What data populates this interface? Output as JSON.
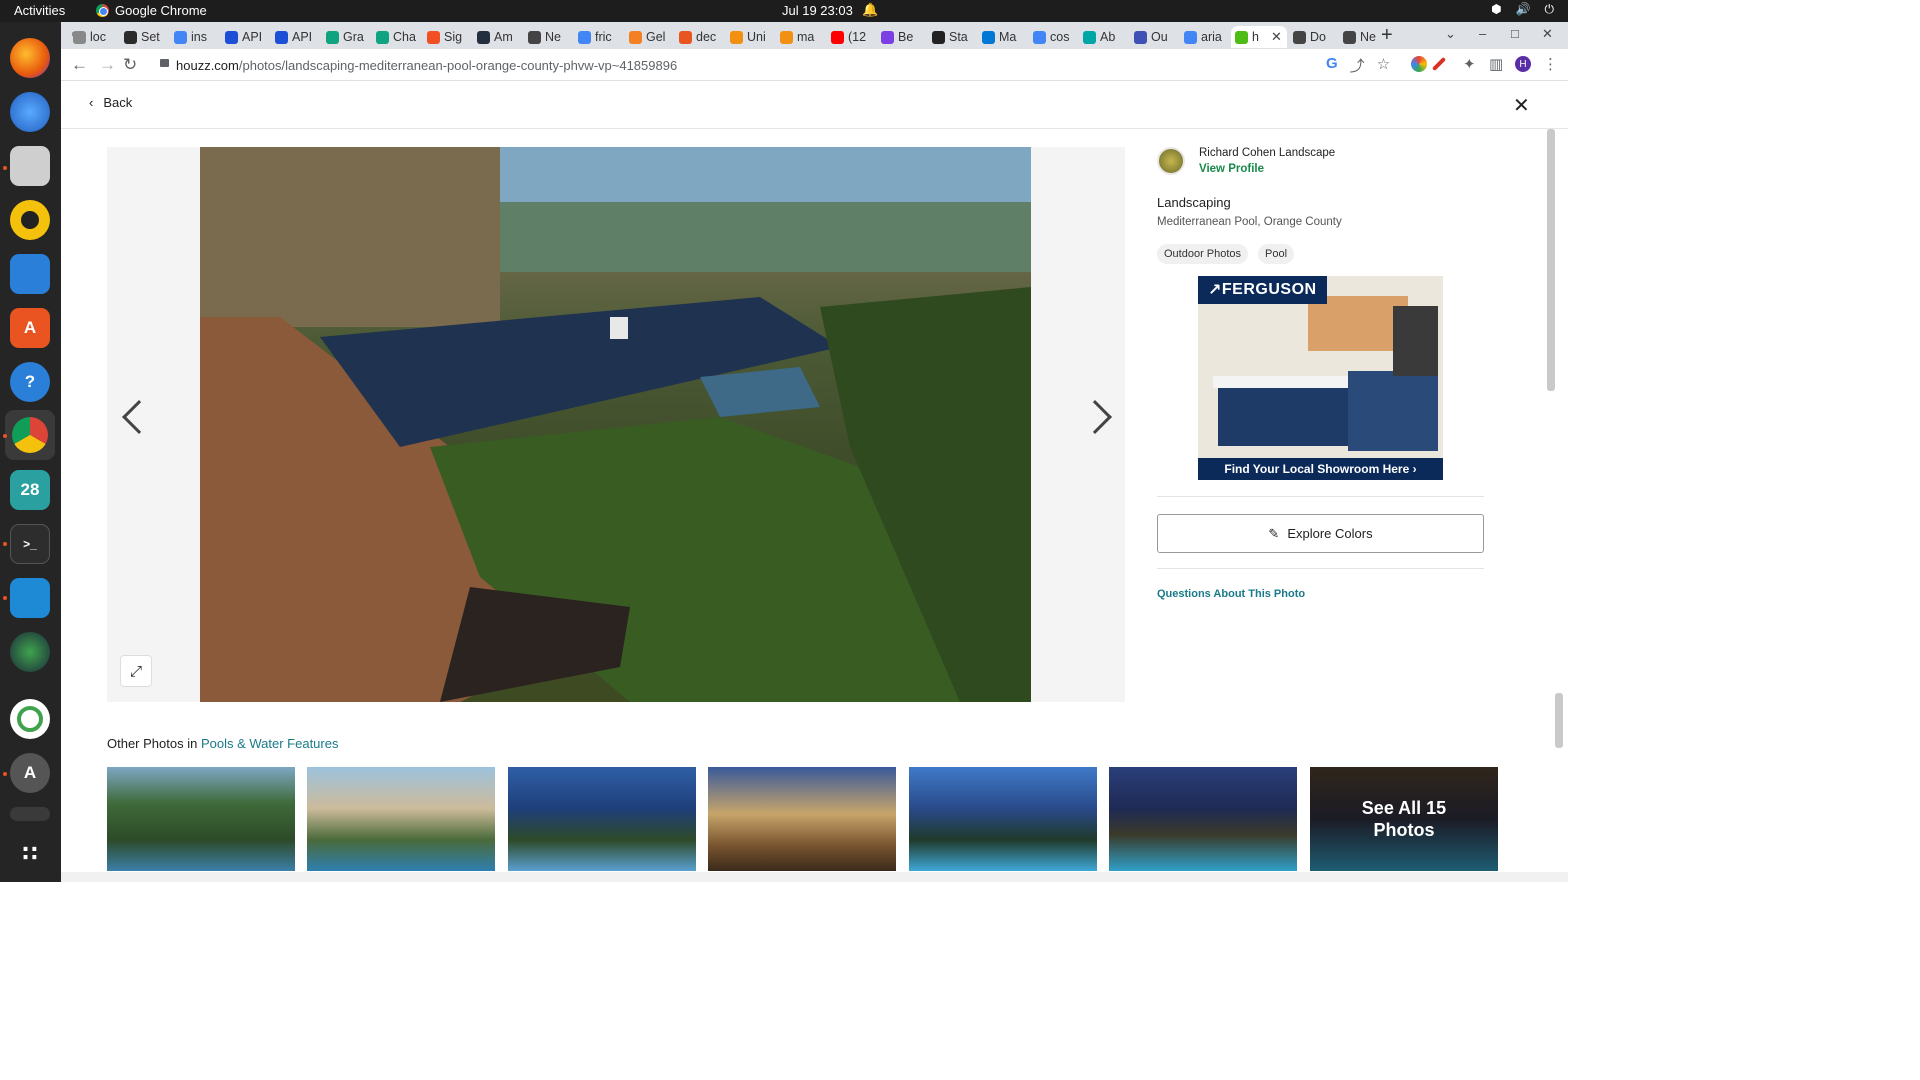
{
  "os": {
    "activities": "Activities",
    "app_name": "Google Chrome",
    "clock": "Jul 19  23:03"
  },
  "tabs": [
    {
      "label": "loc",
      "color": "#888888"
    },
    {
      "label": "Set",
      "color": "#2b2b2b"
    },
    {
      "label": "ins",
      "color": "#4285f4"
    },
    {
      "label": "API",
      "color": "#1a4fd6"
    },
    {
      "label": "API",
      "color": "#1a4fd6"
    },
    {
      "label": "Gra",
      "color": "#10a37f"
    },
    {
      "label": "Cha",
      "color": "#10a37f"
    },
    {
      "label": "Sig",
      "color": "#f25022"
    },
    {
      "label": "Am",
      "color": "#232f3e"
    },
    {
      "label": "Ne",
      "color": "#444444"
    },
    {
      "label": "fric",
      "color": "#4285f4"
    },
    {
      "label": "Gel",
      "color": "#f48024"
    },
    {
      "label": "dec",
      "color": "#e95420"
    },
    {
      "label": "Uni",
      "color": "#f29111"
    },
    {
      "label": "ma",
      "color": "#f29111"
    },
    {
      "label": "(12",
      "color": "#ff0000"
    },
    {
      "label": "Be",
      "color": "#7b3fe4"
    },
    {
      "label": "Sta",
      "color": "#222222"
    },
    {
      "label": "Ma",
      "color": "#0078d4"
    },
    {
      "label": "cos",
      "color": "#4285f4"
    },
    {
      "label": "Ab",
      "color": "#00a6a6"
    },
    {
      "label": "Ou",
      "color": "#3f51b5"
    },
    {
      "label": "aria",
      "color": "#4285f4"
    },
    {
      "label": "h",
      "color": "#4dbc15"
    },
    {
      "label": "Do",
      "color": "#444444"
    },
    {
      "label": "Ne",
      "color": "#444444"
    }
  ],
  "toolbar": {
    "url_host": "houzz.com",
    "url_path": "/photos/landscaping-mediterranean-pool-orange-county-phvw-vp~41859896"
  },
  "page": {
    "back_label": "Back",
    "pro_name": "Richard Cohen Landscape",
    "view_profile": "View Profile",
    "category": "Landscaping",
    "subtitle": "Mediterranean Pool, Orange County",
    "chips": [
      "Outdoor Photos",
      "Pool"
    ],
    "ad_brand": "FERGUSON",
    "ad_cta": "Find Your Local Showroom Here",
    "explore_colors": "Explore Colors",
    "questions_link": "Questions About This Photo",
    "other_photos_prefix": "Other Photos in",
    "other_photos_link": "Pools & Water Features",
    "see_all_line1": "See All 15",
    "see_all_line2": "Photos"
  },
  "colors": {
    "houzz_green": "#4dbc15",
    "link_teal": "#1a7a8a",
    "ferguson_navy": "#0b2a5a"
  },
  "dock_icons": [
    "firefox-icon",
    "thunderbird-icon",
    "files-icon",
    "rhythmbox-icon",
    "writer-icon",
    "software-center-icon",
    "help-icon",
    "chrome-icon",
    "calendar-icon",
    "terminal-icon",
    "vscode-icon",
    "camera-icon",
    "refresh-app-icon",
    "updater-icon",
    "drive-icon",
    "app-grid-icon"
  ],
  "calendar_day": "28"
}
